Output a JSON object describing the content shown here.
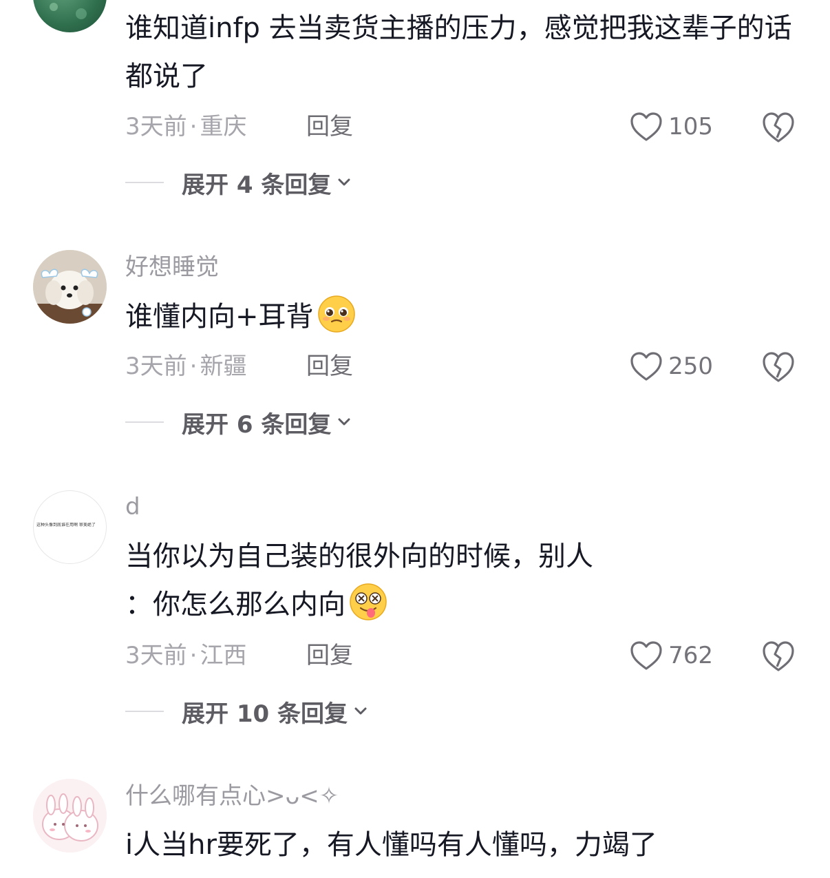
{
  "comments": [
    {
      "username": "",
      "text": "谁知道infp 去当卖货主播的压力，感觉把我这辈子的话都说了",
      "time": "3天前",
      "location": "重庆",
      "reply_label": "回复",
      "likes": "105",
      "expand_label": "展开 4 条回复",
      "avatar_icon": "green-avatar-icon"
    },
    {
      "username": "好想睡觉",
      "text": "谁懂内向+耳背",
      "emoji": "pleading-face-emoji",
      "time": "3天前",
      "location": "新疆",
      "reply_label": "回复",
      "likes": "250",
      "expand_label": "展开 6 条回复",
      "avatar_icon": "white-puppy-avatar-icon"
    },
    {
      "username": "d",
      "text_line1": "当你以为自己装的很外向的时候，别人",
      "text_line2": "：你怎么那么内向",
      "emoji": "dizzy-tongue-face-emoji",
      "avatar_caption": "这种头像到底谁在用啊 审美绝了",
      "time": "3天前",
      "location": "江西",
      "reply_label": "回复",
      "likes": "762",
      "expand_label": "展开 10 条回复",
      "avatar_icon": "text-avatar-icon"
    },
    {
      "username": "什么哪有点心>ᴗ<✧",
      "text": "i人当hr要死了，有人懂吗有人懂吗，力竭了",
      "avatar_icon": "pink-bunny-avatar-icon"
    }
  ],
  "colors": {
    "text": "#161823",
    "muted": "#a5a5ab",
    "username": "#9a9aa0",
    "expand": "#5c5c62"
  }
}
